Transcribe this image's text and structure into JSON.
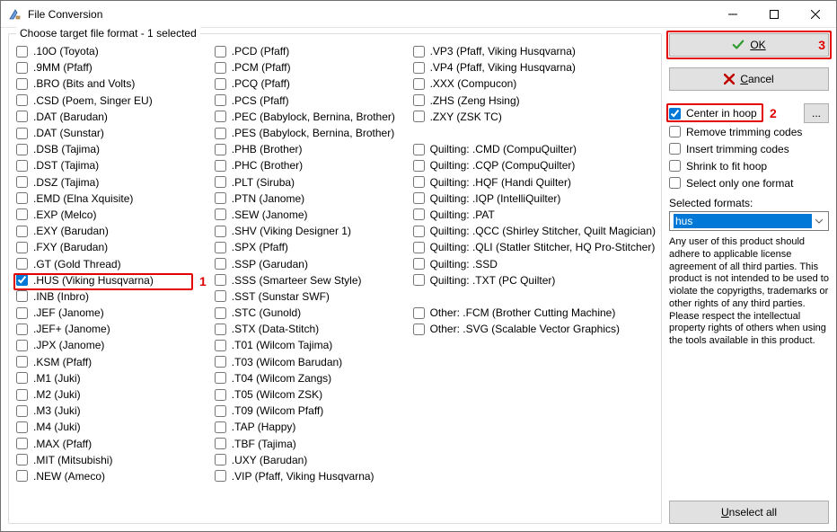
{
  "window": {
    "title": "File Conversion"
  },
  "group_label": "Choose target file format - 1 selected",
  "columns": {
    "col1": [
      ".10O (Toyota)",
      ".9MM (Pfaff)",
      ".BRO (Bits and Volts)",
      ".CSD (Poem, Singer EU)",
      ".DAT (Barudan)",
      ".DAT (Sunstar)",
      ".DSB (Tajima)",
      ".DST (Tajima)",
      ".DSZ (Tajima)",
      ".EMD (Elna Xquisite)",
      ".EXP (Melco)",
      ".EXY (Barudan)",
      ".FXY (Barudan)",
      ".GT (Gold Thread)",
      ".HUS (Viking Husqvarna)",
      ".INB (Inbro)",
      ".JEF (Janome)",
      ".JEF+ (Janome)",
      ".JPX (Janome)",
      ".KSM (Pfaff)",
      ".M1 (Juki)",
      ".M2 (Juki)",
      ".M3 (Juki)",
      ".M4 (Juki)",
      ".MAX (Pfaff)",
      ".MIT (Mitsubishi)",
      ".NEW (Ameco)"
    ],
    "col2": [
      ".PCD (Pfaff)",
      ".PCM (Pfaff)",
      ".PCQ (Pfaff)",
      ".PCS (Pfaff)",
      ".PEC (Babylock, Bernina, Brother)",
      ".PES (Babylock, Bernina, Brother)",
      ".PHB (Brother)",
      ".PHC (Brother)",
      ".PLT (Siruba)",
      ".PTN (Janome)",
      ".SEW (Janome)",
      ".SHV (Viking Designer 1)",
      ".SPX (Pfaff)",
      ".SSP (Garudan)",
      ".SSS (Smarteer Sew Style)",
      ".SST (Sunstar SWF)",
      ".STC (Gunold)",
      ".STX (Data-Stitch)",
      ".T01 (Wilcom Tajima)",
      ".T03 (Wilcom Barudan)",
      ".T04 (Wilcom Zangs)",
      ".T05 (Wilcom ZSK)",
      ".T09 (Wilcom Pfaff)",
      ".TAP (Happy)",
      ".TBF (Tajima)",
      ".UXY (Barudan)",
      ".VIP (Pfaff, Viking Husqvarna)"
    ],
    "col3_top": [
      ".VP3 (Pfaff, Viking Husqvarna)",
      ".VP4 (Pfaff, Viking Husqvarna)",
      ".XXX (Compucon)",
      ".ZHS (Zeng Hsing)",
      ".ZXY (ZSK TC)"
    ],
    "col3_mid": [
      "Quilting: .CMD (CompuQuilter)",
      "Quilting: .CQP (CompuQuilter)",
      "Quilting: .HQF (Handi Quilter)",
      "Quilting: .IQP (IntelliQuilter)",
      "Quilting: .PAT",
      "Quilting: .QCC (Shirley Stitcher, Quilt Magician)",
      "Quilting: .QLI (Statler Stitcher, HQ Pro-Stitcher)",
      "Quilting: .SSD",
      "Quilting: .TXT (PC Quilter)"
    ],
    "col3_bot": [
      "Other: .FCM (Brother Cutting Machine)",
      "Other: .SVG (Scalable Vector Graphics)"
    ]
  },
  "checked_format_index": 14,
  "annotations": {
    "num1": "1",
    "num2": "2",
    "num3": "3"
  },
  "buttons": {
    "ok": "OK",
    "cancel": "Cancel",
    "unselect": "Unselect all",
    "dots": "..."
  },
  "options": {
    "center": "Center in hoop",
    "remove_trim": "Remove trimming codes",
    "insert_trim": "Insert trimming codes",
    "shrink": "Shrink to fit hoop",
    "select_one": "Select only one format"
  },
  "options_checked": {
    "center": true
  },
  "selected_formats_label": "Selected formats:",
  "combo_value": "hus",
  "disclaimer": "Any user of this product should adhere to applicable license agreement of all third parties. This product is not intended to be used to violate the copyrigths, trademarks or other rights of any third parties. Please respect the intellectual property rights of others when using the tools available in this product."
}
